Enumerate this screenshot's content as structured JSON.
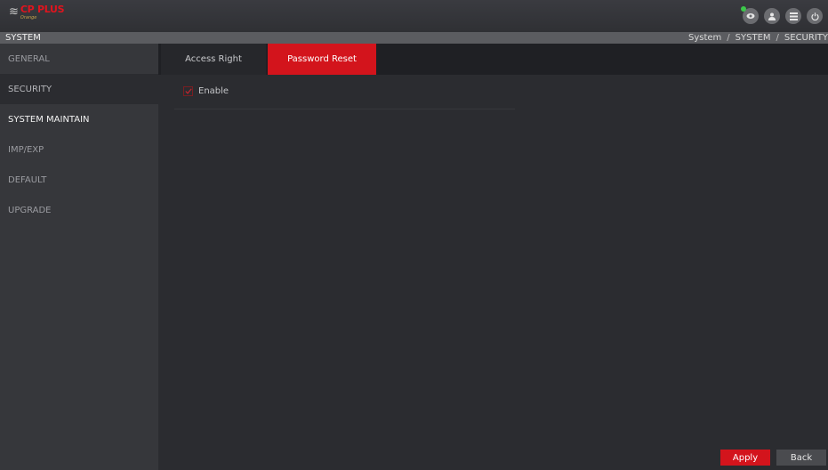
{
  "header": {
    "logo_mark": "≋",
    "logo_brand": "CP PLUS",
    "logo_sub": "Orange",
    "icons": [
      "live-view-icon",
      "user-icon",
      "grid-menu-icon",
      "power-icon"
    ],
    "status_dot_color": "#3cc84a"
  },
  "titlebar": {
    "title": "SYSTEM",
    "breadcrumb": [
      "System",
      "SYSTEM",
      "SECURITY"
    ]
  },
  "sidebar": {
    "items": [
      {
        "label": "GENERAL"
      },
      {
        "label": "SECURITY"
      },
      {
        "label": "SYSTEM MAINTAIN"
      },
      {
        "label": "IMP/EXP"
      },
      {
        "label": "DEFAULT"
      },
      {
        "label": "UPGRADE"
      }
    ]
  },
  "tabs": {
    "access_right": "Access Right",
    "password_reset": "Password Reset"
  },
  "content": {
    "enable_label": "Enable",
    "enable_checked": true
  },
  "footer": {
    "apply_label": "Apply",
    "back_label": "Back"
  },
  "colors": {
    "accent": "#d3141c",
    "background": "#2b2c30",
    "sidebar": "#36373b"
  }
}
